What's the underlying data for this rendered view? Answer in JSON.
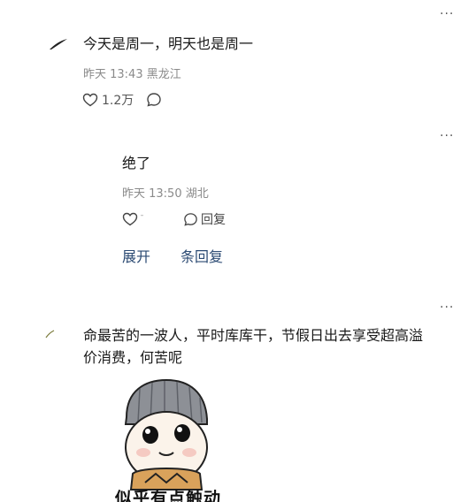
{
  "comment1": {
    "more": "···",
    "text": "今天是周一，明天也是周一",
    "time": "昨天 13:43",
    "location": "黑龙江",
    "likes": "1.2万"
  },
  "reply1": {
    "more": "···",
    "text": "绝了",
    "time": "昨天 13:50",
    "location": "湖北",
    "reply_label": "回复",
    "expand_label": "展开",
    "replies_label": "条回复"
  },
  "comment2": {
    "more": "···",
    "text_line1": "命最苦的一波人，平时库库干，节假日出去享受超高溢",
    "text_line2": "价消费，何苦呢",
    "sticker_caption": "似乎有点触动"
  }
}
